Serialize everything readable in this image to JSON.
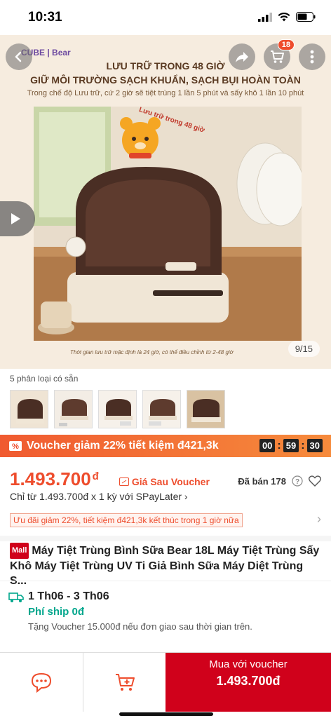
{
  "status_bar": {
    "time": "10:31"
  },
  "hero": {
    "brand": "CUBE | Bear",
    "title_line1": "LƯU TRỮ TRONG 48 GIỜ",
    "title_line2": "GIỮ MÔI TRƯỜNG SẠCH KHUẨN, SẠCH BỤI HOÀN TOÀN",
    "subtitle": "Trong chế độ Lưu trữ, cứ 2 giờ sẽ tiệt trùng 1 lần 5 phút và sấy khô 1 lần 10 phút",
    "bubble_text": "Lưu trữ trong 48 giờ",
    "caption": "Thời gian lưu trữ mặc định là 24 giờ, có thể điều chỉnh từ 2-48 giờ",
    "page_counter": "9/15",
    "cart_count": "18"
  },
  "variants": {
    "label": "5 phân loại có sẵn",
    "count": 5
  },
  "voucher_bar": {
    "text": "Voucher giảm 22% tiết kiệm đ421,3k",
    "timer": [
      "00",
      "59",
      "30"
    ]
  },
  "price": {
    "value": "1.493.700",
    "currency": "đ",
    "after_voucher": "Giá Sau Voucher",
    "sold": "Đã bán 178",
    "installment": "Chỉ từ 1.493.700đ x 1 kỳ với SPayLater",
    "promo": "Ưu đãi giảm 22%, tiết kiệm đ421,3k kết thúc trong 1 giờ nữa"
  },
  "product": {
    "mall_badge": "Mall",
    "title": "Máy Tiệt Trùng Bình Sữa Bear 18L Máy Tiệt Trùng Sấy Khô Máy Tiệt Trùng UV Ti Giả Bình Sữa Máy Diệt Trùng S..."
  },
  "shipping": {
    "date": "1 Th06 - 3 Th06",
    "fee": "Phí ship 0đ",
    "note": "Tặng Voucher 15.000đ nếu đơn giao sau thời gian trên."
  },
  "bottom_bar": {
    "buy_label": "Mua với voucher",
    "buy_price": "1.493.700đ"
  },
  "colors": {
    "accent": "#ee4d2d",
    "mall": "#d0011b",
    "shipping_green": "#00a68c"
  },
  "icons": [
    "back-arrow-icon",
    "share-icon",
    "cart-icon",
    "more-icon",
    "play-icon",
    "help-icon",
    "heart-icon",
    "chevron-right-icon",
    "truck-icon",
    "chat-icon",
    "add-to-cart-icon"
  ]
}
